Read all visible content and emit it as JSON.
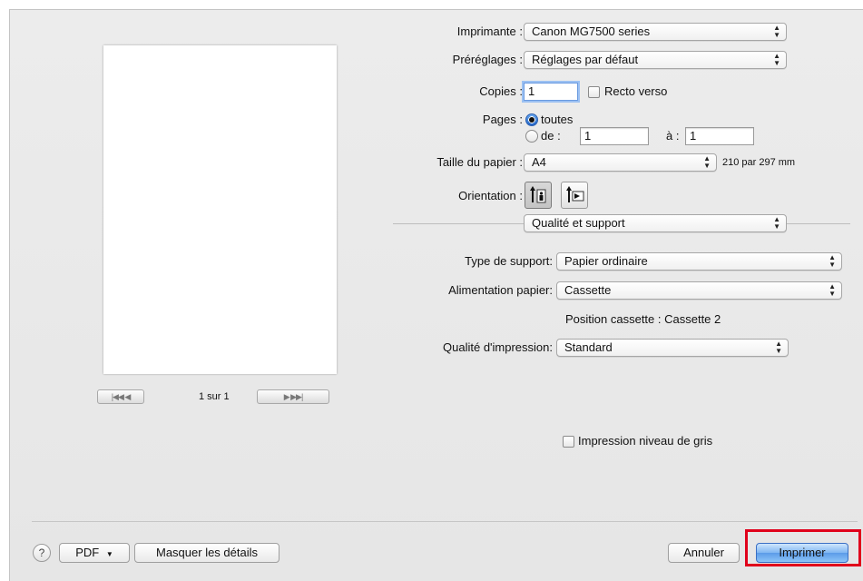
{
  "preview": {
    "nav_first_prev": "|◀◀  ◀",
    "nav_next_last": "▶  ▶▶|",
    "page_count": "1 sur 1"
  },
  "printer": {
    "label": "Imprimante :",
    "value": "Canon MG7500 series"
  },
  "presets": {
    "label": "Préréglages :",
    "value": "Réglages par défaut"
  },
  "copies": {
    "label": "Copies :",
    "value": "1",
    "duplex_label": "Recto verso"
  },
  "pages": {
    "label": "Pages :",
    "all_label": "toutes",
    "from_label": "de :",
    "from_value": "1",
    "to_label": "à :",
    "to_value": "1"
  },
  "paper_size": {
    "label": "Taille du papier :",
    "value": "A4",
    "dimensions": "210 par 297 mm"
  },
  "orientation": {
    "label": "Orientation :"
  },
  "panel_select": {
    "value": "Qualité et support"
  },
  "media_type": {
    "label": "Type de support:",
    "value": "Papier ordinaire"
  },
  "paper_source": {
    "label": "Alimentation papier:",
    "value": "Cassette"
  },
  "cassette_position": "Position cassette : Cassette 2",
  "print_quality": {
    "label": "Qualité d'impression:",
    "value": "Standard"
  },
  "grayscale": {
    "label": "Impression niveau de gris"
  },
  "footer": {
    "help": "?",
    "pdf_label": "PDF",
    "hide_details_label": "Masquer les détails",
    "cancel_label": "Annuler",
    "print_label": "Imprimer"
  },
  "colors": {
    "highlight": "#e0001b",
    "default_button": "#5b9be8"
  }
}
